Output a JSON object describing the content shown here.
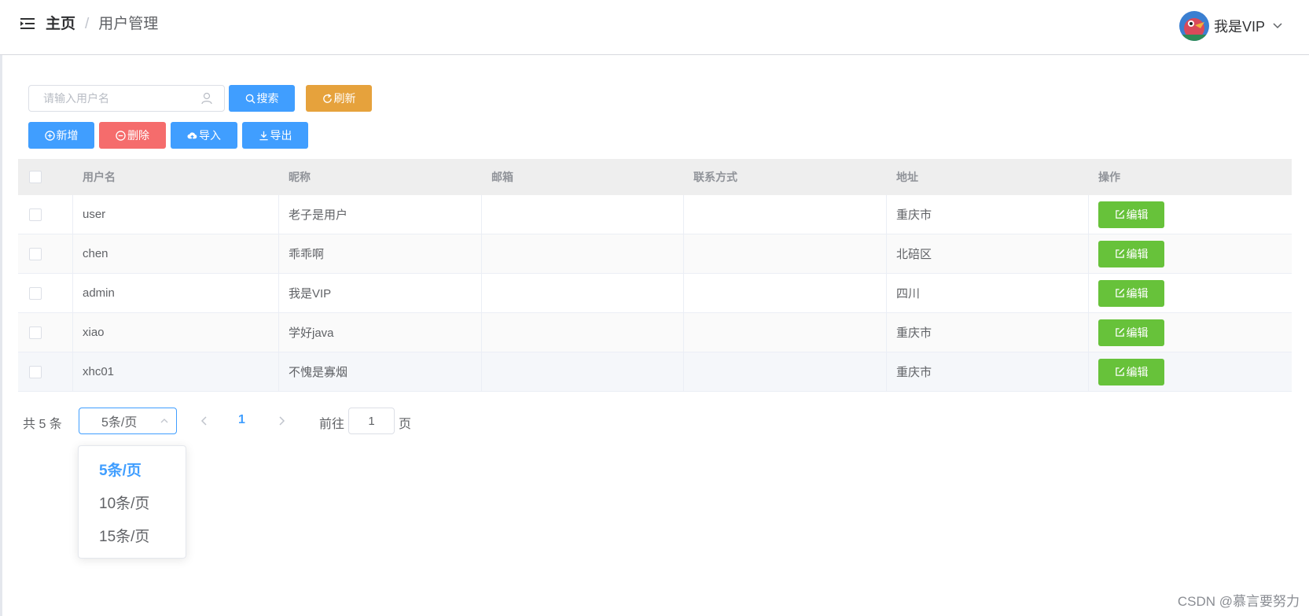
{
  "header": {
    "breadcrumb_home": "主页",
    "breadcrumb_separator": "/",
    "breadcrumb_current": "用户管理",
    "user_name": "我是VIP"
  },
  "toolbar": {
    "search_placeholder": "请输入用户名",
    "search_label": "搜索",
    "refresh_label": "刷新",
    "add_label": "新增",
    "delete_label": "删除",
    "import_label": "导入",
    "export_label": "导出"
  },
  "table": {
    "columns": [
      "用户名",
      "昵称",
      "邮箱",
      "联系方式",
      "地址",
      "操作"
    ],
    "rows": [
      {
        "username": "user",
        "nickname": "老子是用户",
        "email": "",
        "phone": "",
        "address": "重庆市"
      },
      {
        "username": "chen",
        "nickname": "乖乖啊",
        "email": "",
        "phone": "",
        "address": "北碚区"
      },
      {
        "username": "admin",
        "nickname": "我是VIP",
        "email": "",
        "phone": "",
        "address": "四川"
      },
      {
        "username": "xiao",
        "nickname": "学好java",
        "email": "",
        "phone": "",
        "address": "重庆市"
      },
      {
        "username": "xhc01",
        "nickname": "不愧是寡烟",
        "email": "",
        "phone": "",
        "address": "重庆市"
      }
    ],
    "edit_label": "编辑"
  },
  "pagination": {
    "total_text": "共 5 条",
    "page_size_selected": "5条/页",
    "page_size_options": [
      "5条/页",
      "10条/页",
      "15条/页"
    ],
    "current_page": "1",
    "goto_label": "前往",
    "goto_value": "1",
    "page_suffix": "页"
  },
  "watermark": "CSDN @慕言要努力",
  "colors": {
    "primary": "#409eff",
    "warning": "#e6a23c",
    "danger": "#f56c6c",
    "success": "#67c23a"
  }
}
